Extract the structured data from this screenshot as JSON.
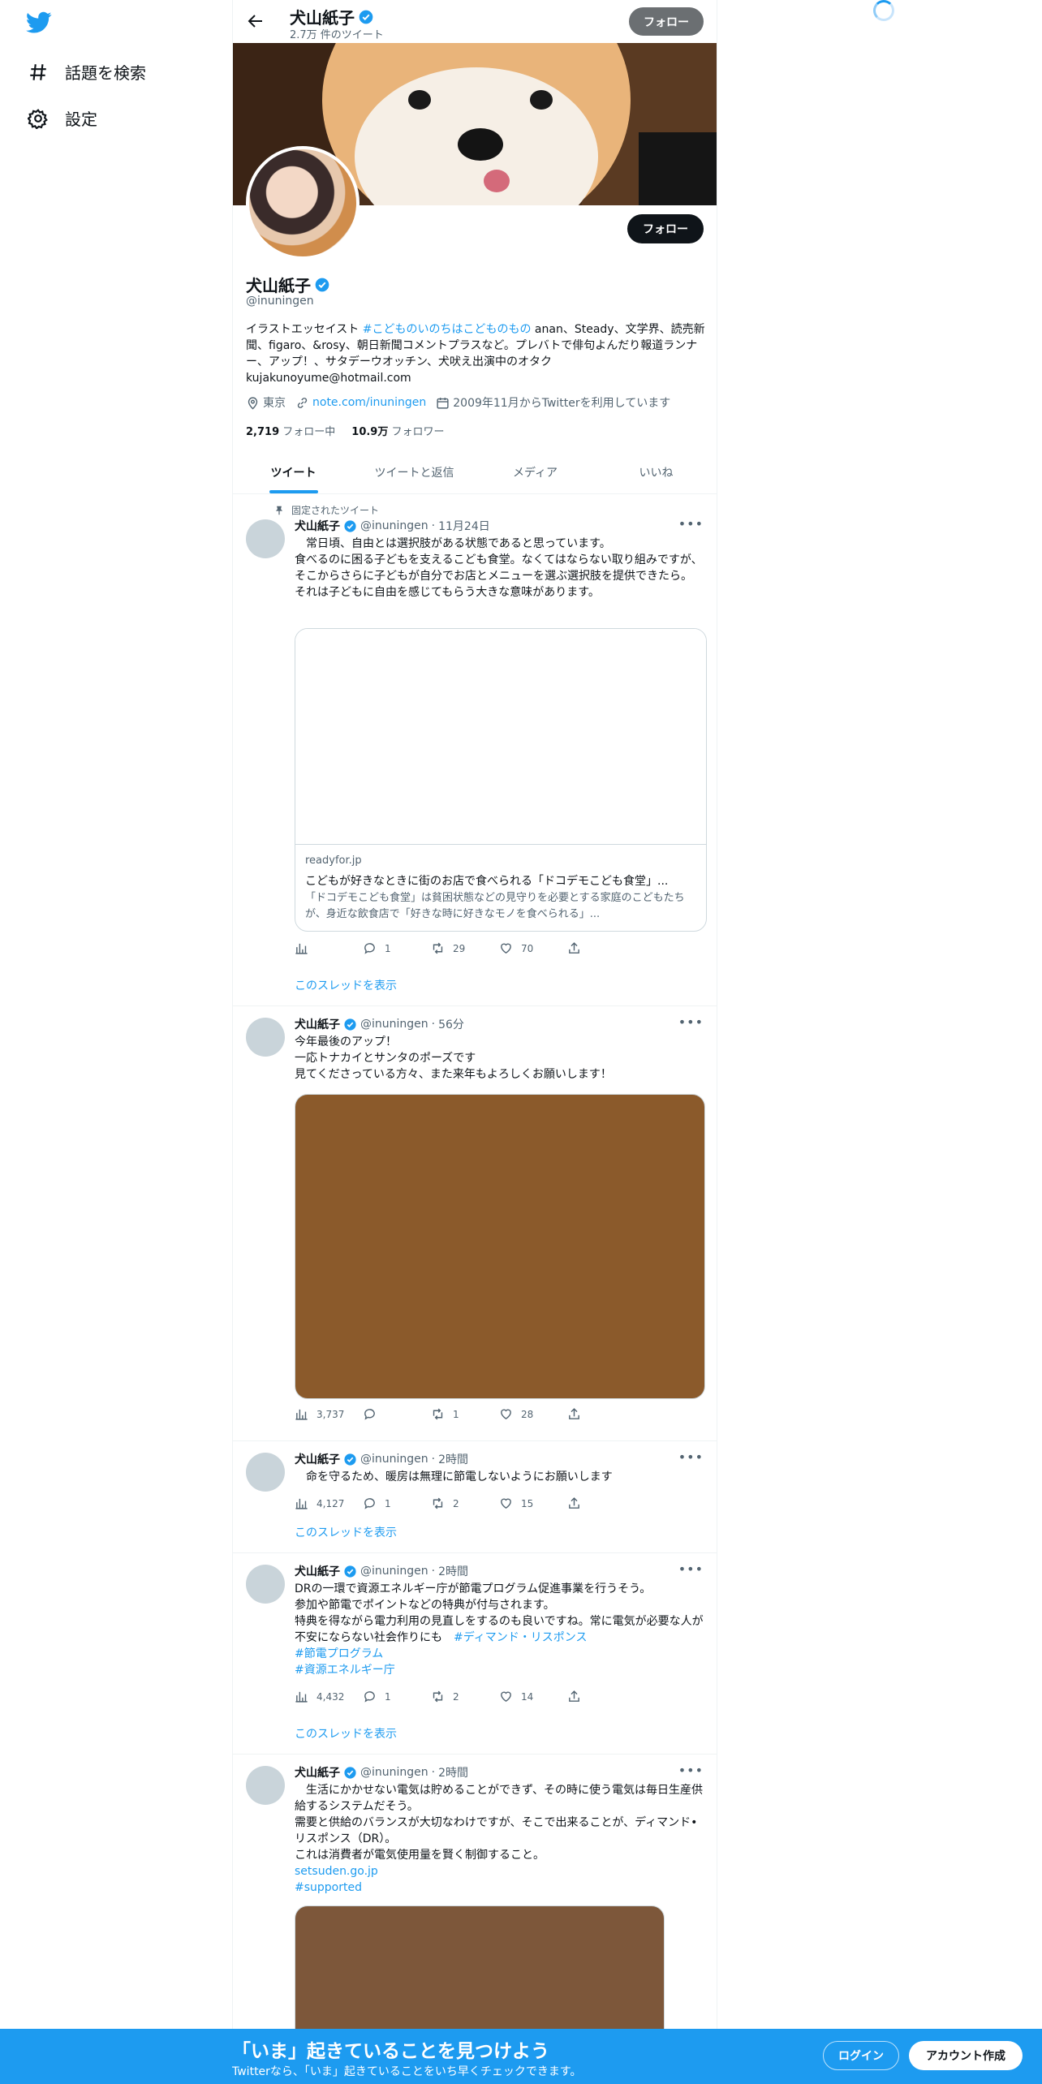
{
  "nav": {
    "logo_icon": "twitter-bird-icon",
    "items": [
      {
        "label": "話題を検索",
        "icon": "hashtag-icon"
      },
      {
        "label": "設定",
        "icon": "gear-icon"
      }
    ]
  },
  "header": {
    "name": "犬山紙子",
    "tweet_count": "2.7万 件のツイート",
    "follow_label": "フォロー"
  },
  "profile": {
    "name": "犬山紙子",
    "handle": "@inuningen",
    "follow_label": "フォロー",
    "bio_prefix": "イラストエッセイスト ",
    "bio_hashtag": "#こどものいのちはこどものもの",
    "bio_rest": " anan、Steady、文学界、読売新聞、figaro、&rosy、朝日新聞コメントプラスなど。プレバトで俳句よんだり報道ランナー、アップ！、サタデーウオッチン、犬吠え出演中のオタク kujakunoyume@hotmail.com",
    "location": "東京",
    "website": "note.com/inuningen",
    "joined": "2009年11月からTwitterを利用しています",
    "following_count": "2,719",
    "following_label": "フォロー中",
    "followers_count": "10.9万",
    "followers_label": "フォロワー"
  },
  "tabs": [
    {
      "label": "ツイート",
      "active": true
    },
    {
      "label": "ツイートと返信"
    },
    {
      "label": "メディア"
    },
    {
      "label": "いいね"
    }
  ],
  "tweets": [
    {
      "pinned_label": "固定されたツイート",
      "name": "犬山紙子",
      "handle": "@inuningen",
      "time": "11月24日",
      "text": "　常日頃、自由とは選択肢がある状態であると思っています。\n食べるのに困る子どもを支えるこども食堂。なくてはならない取り組みですが、そこからさらに子どもが自分でお店とメニューを選ぶ選択肢を提供できたら。\nそれは子どもに自由を感じてもらう大きな意味があります。",
      "card": {
        "domain": "readyfor.jp",
        "title": "こどもが好きなときに街のお店で食べられる「ドコデモこども食堂」...",
        "desc": "「ドコデモこども食堂」は貧困状態などの見守りを必要とする家庭のこどもたちが、身近な飲食店で「好きな時に好きなモノを食べられる」..."
      },
      "views": "",
      "replies": "1",
      "retweets": "29",
      "likes": "70",
      "show_thread": "このスレッドを表示"
    },
    {
      "name": "犬山紙子",
      "handle": "@inuningen",
      "time": "56分",
      "text": "今年最後のアップ！\n一応トナカイとサンタのポーズです\n見てくださっている方々、また来年もよろしくお願いします！",
      "media_color": "#8b5a2b",
      "views": "3,737",
      "replies": "",
      "retweets": "1",
      "likes": "28"
    },
    {
      "name": "犬山紙子",
      "handle": "@inuningen",
      "time": "2時間",
      "text": "　命を守るため、暖房は無理に節電しないようにお願いします",
      "views": "4,127",
      "replies": "1",
      "retweets": "2",
      "likes": "15",
      "show_thread": "このスレッドを表示"
    },
    {
      "name": "犬山紙子",
      "handle": "@inuningen",
      "time": "2時間",
      "text": "DRの一環で資源エネルギー庁が節電プログラム促進事業を行うそう。\n参加や節電でポイントなどの特典が付与されます。\n特典を得ながら電力利用の見直しをするのも良いですね。常に電気が必要な人が不安にならない社会作りにも",
      "hashtag1": "#ディマンド・リスポンス",
      "hashtag2": "#節電プログラム",
      "hashtag3": "#資源エネルギー庁",
      "views": "4,432",
      "replies": "1",
      "retweets": "2",
      "likes": "14",
      "show_thread": "このスレッドを表示"
    },
    {
      "name": "犬山紙子",
      "handle": "@inuningen",
      "time": "2時間",
      "text": "　生活にかかせない電気は貯めることができず、その時に使う電気は毎日生産供給するシステムだそう。\n需要と供給のバランスが大切なわけですが、そこで出来ることが、ディマンド•リスポンス（DR）。\nこれは消費者が電気使用量を賢く制御すること。",
      "link": "setsuden.go.jp",
      "hashtag": "#supported",
      "media_color": "#7d573a"
    }
  ],
  "bottom_bar": {
    "title": "「いま」起きていることを見つけよう",
    "subtitle": "Twitterなら、「いま」起きていることをいち早くチェックできます。",
    "login_label": "ログイン",
    "signup_label": "アカウント作成"
  },
  "colors": {
    "accent": "#1d9bf0",
    "text": "#0f1419",
    "muted": "#536471"
  }
}
